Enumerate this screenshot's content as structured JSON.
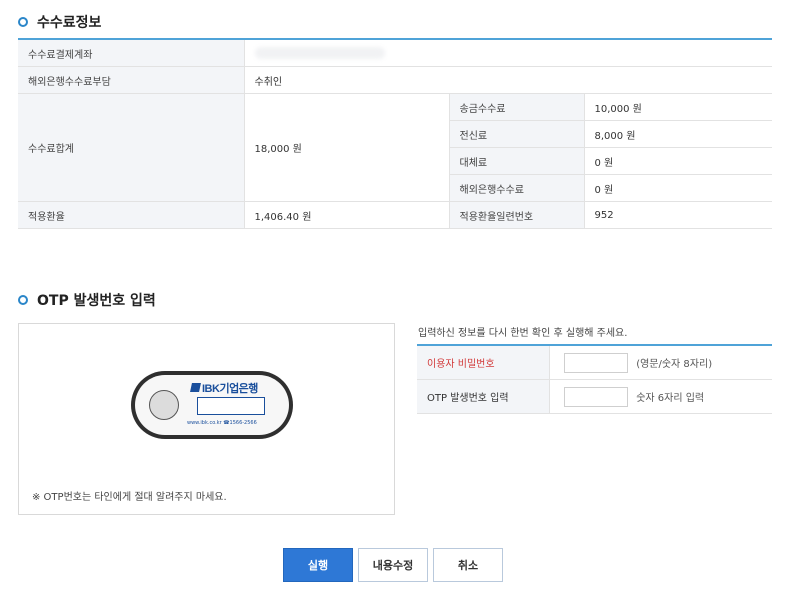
{
  "fee_section": {
    "title": "수수료정보",
    "rows": {
      "payment_account": {
        "label": "수수료결제계좌",
        "value": ""
      },
      "overseas_fee_payer": {
        "label": "해외은행수수료부담",
        "value": "수취인"
      },
      "fee_total": {
        "label": "수수료합계",
        "value": "18,000 원",
        "breakdown": [
          {
            "label": "송금수수료",
            "value": "10,000 원"
          },
          {
            "label": "전신료",
            "value": "8,000 원"
          },
          {
            "label": "대체료",
            "value": "0 원"
          },
          {
            "label": "해외은행수수료",
            "value": "0 원"
          }
        ]
      },
      "exchange_rate": {
        "label": "적용환율",
        "value": "1,406.40 원",
        "serial_label": "적용환율일련번호",
        "serial_value": "952"
      }
    }
  },
  "otp_section": {
    "title": "OTP 발생번호 입력",
    "device": {
      "logo_text": "IBK기업은행",
      "footer_text": "www.ibk.co.kr ☎1566-2566"
    },
    "notice": "※ OTP번호는 타인에게 절대 알려주지 마세요.",
    "instruction": "입력하신 정보를 다시 한번 확인 후 실행해 주세요.",
    "fields": {
      "password": {
        "label": "이용자 비밀번호",
        "value": "",
        "hint": "(영문/숫자 8자리)"
      },
      "otp": {
        "label": "OTP 발생번호 입력",
        "value": "",
        "hint": "숫자 6자리 입력"
      }
    }
  },
  "buttons": {
    "execute": "실행",
    "modify": "내용수정",
    "cancel": "취소"
  },
  "colors": {
    "accent": "#2e78d6",
    "table_border": "#4fa3d8",
    "required_label": "#d23a3a",
    "brand_logo": "#1a4f9c"
  },
  "icons": {
    "section_bullet": "circle-bullet-icon",
    "otp_device": "otp-token-icon"
  }
}
